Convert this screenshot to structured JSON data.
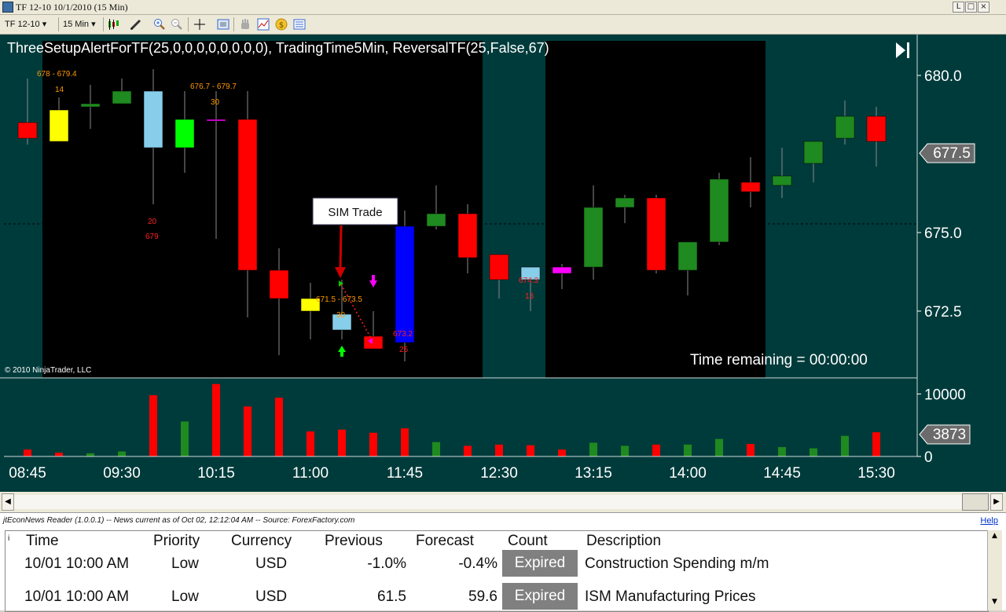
{
  "window": {
    "title": "TF 12-10  10/1/2010 (15 Min)",
    "buttons": [
      "L",
      "□",
      "×"
    ]
  },
  "toolbar": {
    "instrument": "TF 12-10",
    "interval": "15 Min",
    "icons": [
      "candlestick-icon",
      "pencil-icon",
      "zoom-in-icon",
      "zoom-out-icon",
      "crosshair-icon",
      "properties-icon",
      "hand-icon",
      "chart-icon",
      "dollar-icon",
      "data-box-icon"
    ]
  },
  "chart": {
    "indicator_label": "ThreeSetupAlertForTF(25,0,0,0,0,0,0,0,0), TradingTime5Min, ReversalTF(25,False,67)",
    "copyright": "© 2010 NinjaTrader, LLC",
    "time_remaining": "Time remaining = 00:00:00",
    "sim_trade_label": "SIM Trade",
    "price_axis_labels": [
      "680.0",
      "677.5",
      "675.0",
      "672.5"
    ],
    "price_axis_values": [
      680.0,
      677.5,
      675.0,
      672.5
    ],
    "last_price": "677.5",
    "volume_axis_labels": [
      "10000",
      "0"
    ],
    "volume_axis_values": [
      10000,
      0
    ],
    "last_volume": "3873",
    "time_axis_labels": [
      "08:45",
      "09:30",
      "10:15",
      "11:00",
      "11:45",
      "12:30",
      "13:15",
      "14:00",
      "14:45",
      "15:30"
    ],
    "annotations": [
      {
        "text": "678 - 679.4",
        "color": "#ff9900"
      },
      {
        "text": "14",
        "color": "#ff9900"
      },
      {
        "text": "676.7 - 679.7",
        "color": "#ff9900"
      },
      {
        "text": "30",
        "color": "#ff9900"
      },
      {
        "text": "20",
        "color": "#ff2020"
      },
      {
        "text": "679",
        "color": "#ff2020"
      },
      {
        "text": "671.5 - 673.5",
        "color": "#ff9900"
      },
      {
        "text": "30",
        "color": "#ff9900"
      },
      {
        "text": "673.2",
        "color": "#ff2020"
      },
      {
        "text": "25",
        "color": "#ff2020"
      },
      {
        "text": "674.3",
        "color": "#ff2020"
      },
      {
        "text": "13",
        "color": "#ff2020"
      }
    ],
    "colors": {
      "background": "#003b3b",
      "session_black": "#000000",
      "up": "#1f8a1f",
      "down": "#ff0000",
      "axis_text": "#ffffff"
    }
  },
  "chart_data": {
    "type": "candlestick",
    "x": [
      "08:45",
      "09:00",
      "09:15",
      "09:30",
      "09:45",
      "10:00",
      "10:15",
      "10:30",
      "10:45",
      "11:00",
      "11:15",
      "11:30",
      "11:45",
      "12:00",
      "12:15",
      "12:30",
      "12:45",
      "13:00",
      "13:15",
      "13:30",
      "13:45",
      "14:00",
      "14:15",
      "14:30",
      "14:45",
      "15:00",
      "15:15",
      "15:30"
    ],
    "bars": [
      {
        "open": 678.5,
        "high": 679.9,
        "low": 677.8,
        "close": 678.0,
        "color": "#ff0000",
        "volume": 1100
      },
      {
        "open": 677.9,
        "high": 679.3,
        "low": 677.9,
        "close": 678.9,
        "color": "#ffff00",
        "volume": 600
      },
      {
        "open": 679.0,
        "high": 679.7,
        "low": 678.3,
        "close": 679.1,
        "color": "#1f8a1f",
        "volume": 500
      },
      {
        "open": 679.1,
        "high": 679.9,
        "low": 679.1,
        "close": 679.5,
        "color": "#1f8a1f",
        "volume": 800
      },
      {
        "open": 679.5,
        "high": 680.2,
        "low": 675.9,
        "close": 677.7,
        "color": "#87ceeb",
        "volume": 9800
      },
      {
        "open": 677.7,
        "high": 679.5,
        "low": 676.9,
        "close": 678.6,
        "color": "#00ff00",
        "volume": 5600
      },
      {
        "open": 678.6,
        "high": 679.5,
        "low": 674.8,
        "close": 678.6,
        "color": "#ff00ff",
        "volume": 11600
      },
      {
        "open": 678.6,
        "high": 679.5,
        "low": 672.3,
        "close": 673.8,
        "color": "#ff0000",
        "volume": 8000
      },
      {
        "open": 673.8,
        "high": 674.5,
        "low": 671.1,
        "close": 672.9,
        "color": "#ff0000",
        "volume": 9400
      },
      {
        "open": 672.9,
        "high": 673.4,
        "low": 671.6,
        "close": 672.5,
        "color": "#ffff00",
        "volume": 4000
      },
      {
        "open": 671.9,
        "high": 673.5,
        "low": 671.6,
        "close": 672.4,
        "color": "#87ceeb",
        "volume": 4300
      },
      {
        "open": 671.7,
        "high": 672.5,
        "low": 671.3,
        "close": 671.3,
        "color": "#ff0000",
        "volume": 3800
      },
      {
        "open": 671.5,
        "high": 675.7,
        "low": 670.9,
        "close": 675.2,
        "color": "#0000ff",
        "volume": 4500
      },
      {
        "open": 675.2,
        "high": 676.5,
        "low": 675.1,
        "close": 675.6,
        "color": "#1f8a1f",
        "volume": 2300
      },
      {
        "open": 675.6,
        "high": 675.9,
        "low": 673.7,
        "close": 674.2,
        "color": "#ff0000",
        "volume": 1700
      },
      {
        "open": 674.3,
        "high": 674.3,
        "low": 672.9,
        "close": 673.5,
        "color": "#ff0000",
        "volume": 1900
      },
      {
        "open": 673.5,
        "high": 673.9,
        "low": 672.5,
        "close": 673.9,
        "color": "#87ceeb",
        "volume": 1800
      },
      {
        "open": 673.9,
        "high": 674.0,
        "low": 673.2,
        "close": 673.7,
        "color": "#ff00ff",
        "volume": 1100
      },
      {
        "open": 673.9,
        "high": 676.5,
        "low": 673.5,
        "close": 675.8,
        "color": "#1f8a1f",
        "volume": 2200
      },
      {
        "open": 675.8,
        "high": 676.2,
        "low": 675.3,
        "close": 676.1,
        "color": "#1f8a1f",
        "volume": 1700
      },
      {
        "open": 676.1,
        "high": 676.2,
        "low": 673.7,
        "close": 673.8,
        "color": "#ff0000",
        "volume": 1900
      },
      {
        "open": 673.8,
        "high": 674.7,
        "low": 673.0,
        "close": 674.7,
        "color": "#1f8a1f",
        "volume": 1900
      },
      {
        "open": 674.7,
        "high": 676.9,
        "low": 674.6,
        "close": 676.7,
        "color": "#1f8a1f",
        "volume": 2800
      },
      {
        "open": 676.6,
        "high": 677.4,
        "low": 675.8,
        "close": 676.3,
        "color": "#ff0000",
        "volume": 2000
      },
      {
        "open": 676.5,
        "high": 677.7,
        "low": 676.1,
        "close": 676.8,
        "color": "#1f8a1f",
        "volume": 1500
      },
      {
        "open": 677.2,
        "high": 677.9,
        "low": 676.6,
        "close": 677.9,
        "color": "#1f8a1f",
        "volume": 1300
      },
      {
        "open": 678.0,
        "high": 679.2,
        "low": 677.8,
        "close": 678.7,
        "color": "#1f8a1f",
        "volume": 3300
      },
      {
        "open": 678.7,
        "high": 679.0,
        "low": 677.1,
        "close": 677.9,
        "color": "#ff0000",
        "volume": 3873
      }
    ],
    "session_shading": [
      {
        "from": "09:00",
        "to": "12:15",
        "color": "#000000"
      },
      {
        "from": "13:00",
        "to": "14:30",
        "color": "#000000"
      }
    ],
    "ylim": [
      670.5,
      681.0
    ],
    "volume_ylim": [
      0,
      12000
    ],
    "xlabel": "",
    "ylabel": ""
  },
  "news": {
    "header": "jtEconNews Reader (1.0.0.1)  --  News current as of Oct 02, 12:12:04 AM  --  Source: ForexFactory.com",
    "help_link": "Help",
    "columns": [
      "Time",
      "Priority",
      "Currency",
      "Previous",
      "Forecast",
      "Count",
      "Description"
    ],
    "rows": [
      {
        "time": "10/01 10:00 AM",
        "priority": "Low",
        "currency": "USD",
        "previous": "-1.0%",
        "forecast": "-0.4%",
        "count": "Expired",
        "description": "Construction Spending m/m"
      },
      {
        "time": "10/01 10:00 AM",
        "priority": "Low",
        "currency": "USD",
        "previous": "61.5",
        "forecast": "59.6",
        "count": "Expired",
        "description": "ISM Manufacturing Prices"
      }
    ]
  }
}
